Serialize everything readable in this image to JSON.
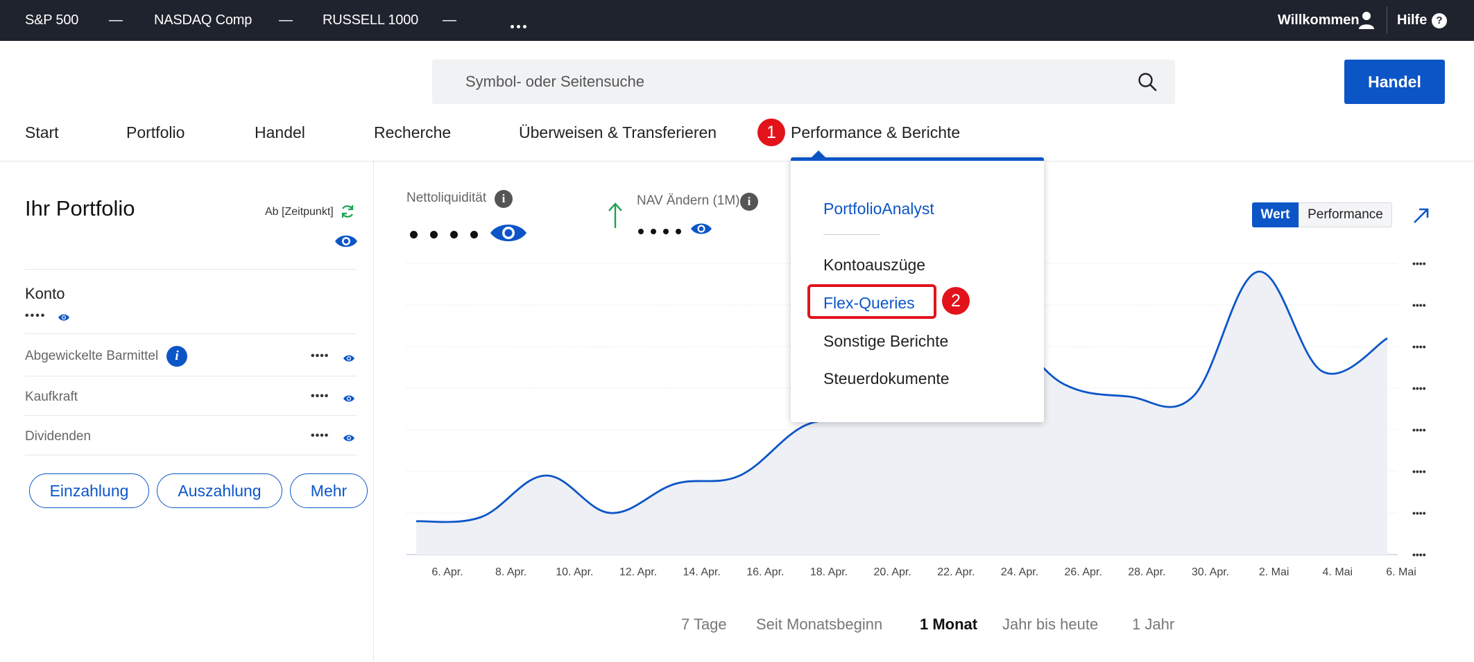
{
  "ticker": {
    "items": [
      {
        "label": "S&P 500",
        "value": "—"
      },
      {
        "label": "NASDAQ Comp",
        "value": "—"
      },
      {
        "label": "RUSSELL 1000",
        "value": "—"
      }
    ],
    "welcome": "Willkommen",
    "help": "Hilfe",
    "help_icon": "?"
  },
  "search": {
    "placeholder": "Symbol- oder Seitensuche"
  },
  "trade_button": "Handel",
  "nav": {
    "items": [
      "Start",
      "Portfolio",
      "Handel",
      "Recherche",
      "Überweisen & Transferieren",
      "Performance & Berichte"
    ]
  },
  "annotations": {
    "badge1": "1",
    "badge2": "2"
  },
  "dropdown": {
    "items": [
      "PortfolioAnalyst",
      "Kontoauszüge",
      "Flex-Queries",
      "Sonstige Berichte",
      "Steuerdokumente"
    ]
  },
  "portfolio": {
    "title": "Ihr Portfolio",
    "as_of": "Ab [Zeitpunkt]",
    "account_label": "Konto",
    "account_value": "••••",
    "rows": [
      {
        "label": "Abgewickelte Barmittel",
        "value": "••••"
      },
      {
        "label": "Kaufkraft",
        "value": "••••"
      },
      {
        "label": "Dividenden",
        "value": "••••"
      }
    ],
    "buttons": [
      "Einzahlung",
      "Auszahlung",
      "Mehr"
    ]
  },
  "metrics": {
    "net_liquidity_label": "Nettoliquidität",
    "nav_change_label": "NAV Ändern (1M)",
    "info_icon": "i"
  },
  "view_toggle": {
    "value": "Wert",
    "performance": "Performance"
  },
  "range": {
    "options": [
      "7 Tage",
      "Seit Monatsbeginn",
      "1 Monat",
      "Jahr bis heute",
      "1 Jahr"
    ],
    "selected": "1 Monat"
  },
  "chart_data": {
    "type": "area",
    "x_labels": [
      "6. Apr.",
      "8. Apr.",
      "10. Apr.",
      "12. Apr.",
      "14. Apr.",
      "16. Apr.",
      "18. Apr.",
      "20. Apr.",
      "22. Apr.",
      "24. Apr.",
      "26. Apr.",
      "28. Apr.",
      "30. Apr.",
      "2. Mai",
      "4. Mai",
      "6. Mai"
    ],
    "y_tick_labels": [
      "••••",
      "••••",
      "••••",
      "••••",
      "••••",
      "••••",
      "••••",
      "••••"
    ],
    "ylim": [
      0,
      7
    ],
    "values": [
      0.8,
      0.9,
      1.9,
      1.0,
      1.7,
      1.9,
      3.1,
      3.4,
      4.9,
      5.4,
      4.1,
      3.8,
      3.8,
      6.8,
      4.4,
      5.2
    ],
    "grid": true,
    "series_color": "#0c55c7",
    "area_color": "#eef0f5"
  }
}
